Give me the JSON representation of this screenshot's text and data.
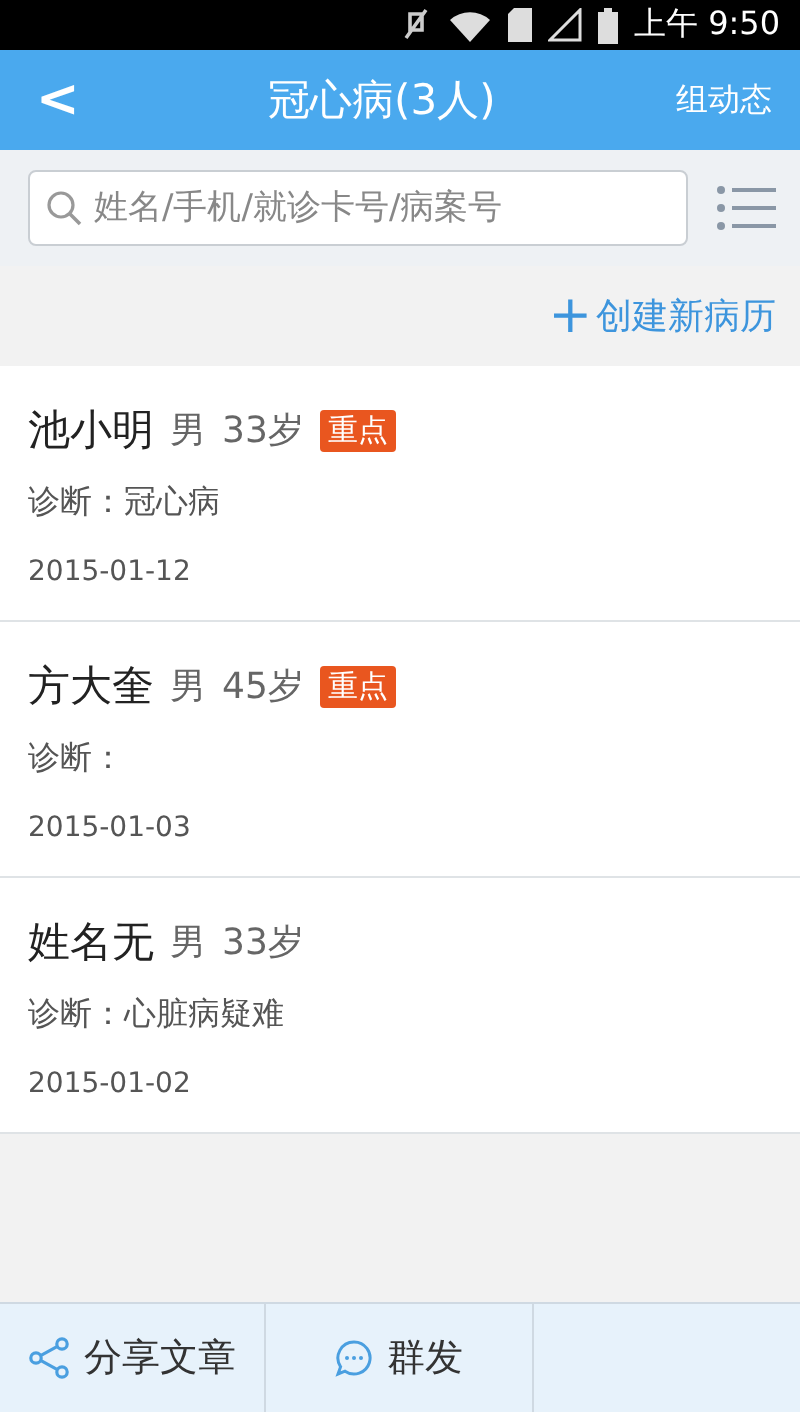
{
  "status_bar": {
    "time": "上午 9:50"
  },
  "header": {
    "back": "<",
    "title": "冠心病(3人)",
    "action": "组动态"
  },
  "search": {
    "placeholder": "姓名/手机/就诊卡号/病案号"
  },
  "create_button": {
    "icon": "+",
    "label": "创建新病历"
  },
  "patients": [
    {
      "name": "池小明",
      "gender": "男",
      "age": "33岁",
      "badge": "重点",
      "key": true,
      "diagnosis": "诊断：冠心病",
      "date": "2015-01-12"
    },
    {
      "name": "方大奎",
      "gender": "男",
      "age": "45岁",
      "badge": "重点",
      "key": true,
      "diagnosis": "诊断：",
      "date": "2015-01-03"
    },
    {
      "name": "姓名无",
      "gender": "男",
      "age": "33岁",
      "key": false,
      "diagnosis": "诊断：心脏病疑难",
      "date": "2015-01-02"
    }
  ],
  "bottom_bar": [
    {
      "kind": "share",
      "label": "分享文章"
    },
    {
      "kind": "message",
      "label": "群发"
    },
    {
      "kind": "blank"
    }
  ]
}
